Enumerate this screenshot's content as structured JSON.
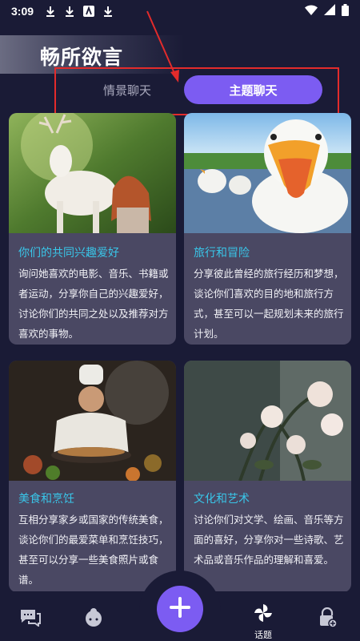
{
  "status_bar": {
    "time": "3:09"
  },
  "header": {
    "title": "畅所欲言"
  },
  "tabs": [
    {
      "label": "情景聊天",
      "active": false
    },
    {
      "label": "主题聊天",
      "active": true
    }
  ],
  "cards": [
    {
      "title": "你们的共同兴趣爱好",
      "description": "询问她喜欢的电影、音乐、书籍或者运动，分享你自己的兴趣爱好，讨论你们的共同之处以及推荐对方喜欢的事物。"
    },
    {
      "title": "旅行和冒险",
      "description": "分享彼此曾经的旅行经历和梦想，谈论你们喜欢的目的地和旅行方式，甚至可以一起规划未来的旅行计划。"
    },
    {
      "title": "美食和烹饪",
      "description": "互相分享家乡或国家的传统美食，谈论你们的最爱菜单和烹饪技巧，甚至可以分享一些美食照片或食谱。"
    },
    {
      "title": "文化和艺术",
      "description": "讨论你们对文学、绘画、音乐等方面的喜好，分享你对一些诗歌、艺术品或音乐作品的理解和喜爱。"
    }
  ],
  "bottom_nav": {
    "topic_label": "话题"
  },
  "colors": {
    "background": "#1a1b36",
    "accent": "#7c5cf2",
    "card_title": "#39c6e9",
    "card_bg": "#4a4863",
    "annotation": "#e32b2b"
  }
}
